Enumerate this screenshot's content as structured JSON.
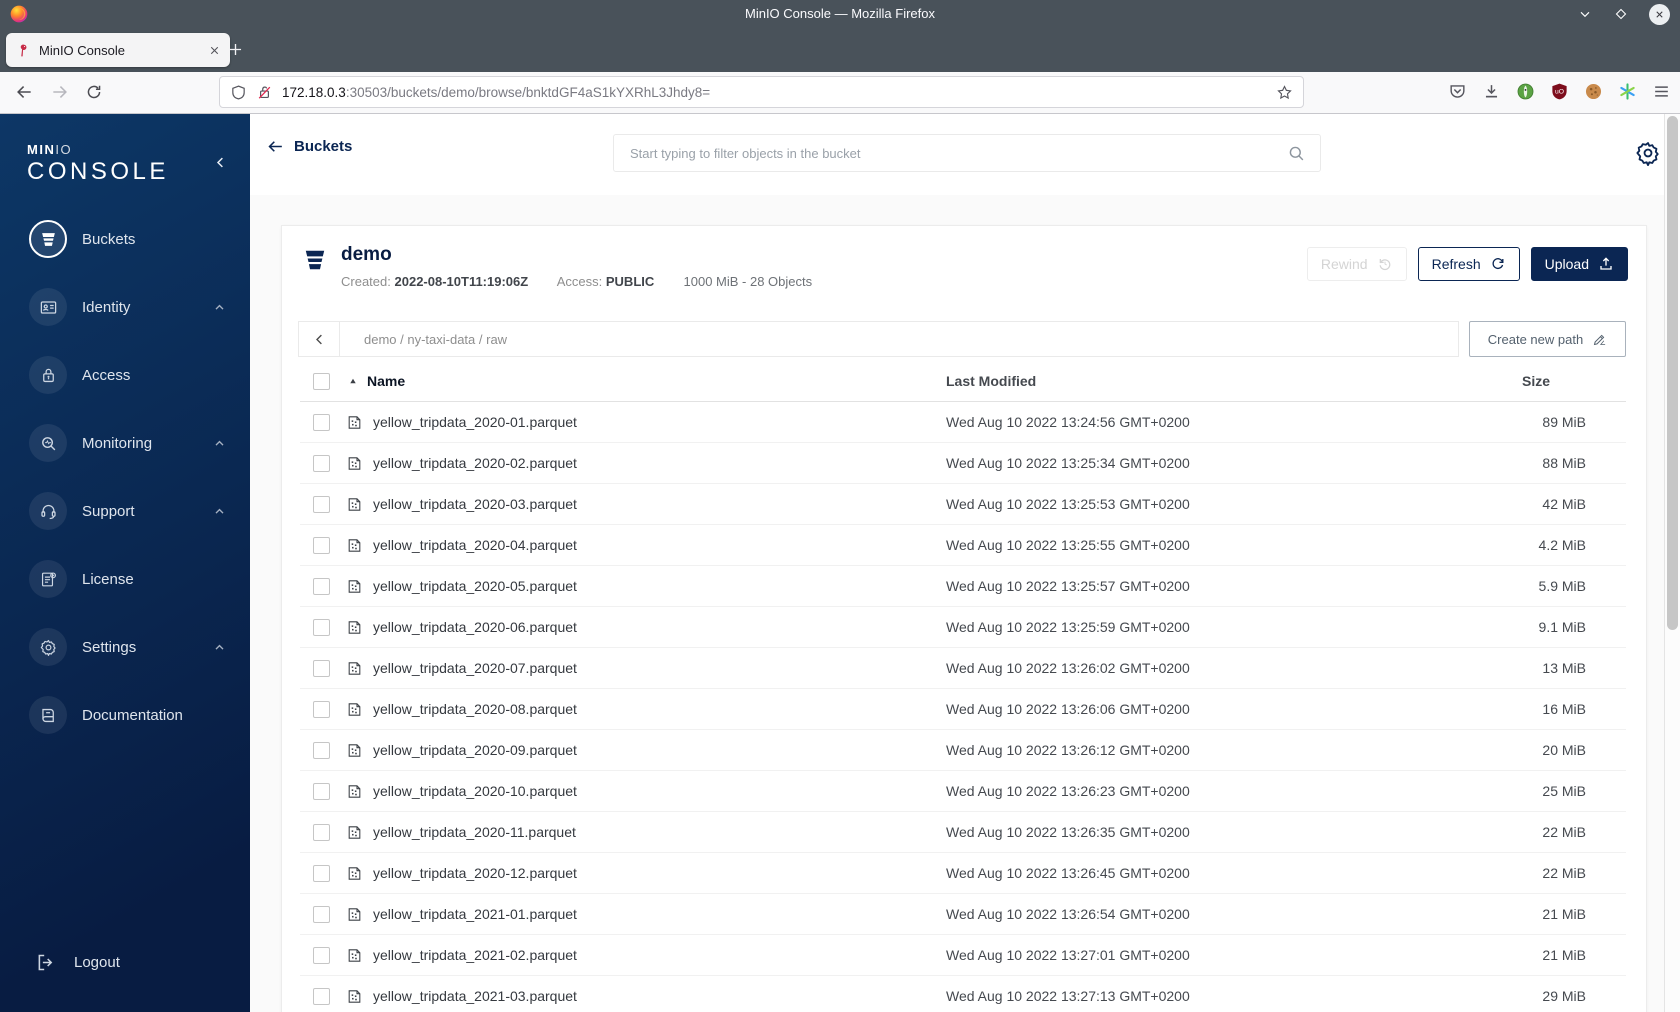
{
  "window": {
    "title": "MinIO Console — Mozilla Firefox"
  },
  "browser": {
    "tab_title": "MinIO Console",
    "url_host": "172.18.0.3",
    "url_rest": ":30503/buckets/demo/browse/bnktdGF4aS1kYXRhL3Jhdy8="
  },
  "sidebar": {
    "brand_min": "MIN",
    "brand_io": "IO",
    "brand_console": "CONSOLE",
    "items": [
      {
        "label": "Buckets",
        "icon": "bucket-icon",
        "active": true,
        "expandable": false
      },
      {
        "label": "Identity",
        "icon": "identity-icon",
        "active": false,
        "expandable": true
      },
      {
        "label": "Access",
        "icon": "access-icon",
        "active": false,
        "expandable": false
      },
      {
        "label": "Monitoring",
        "icon": "monitoring-icon",
        "active": false,
        "expandable": true
      },
      {
        "label": "Support",
        "icon": "support-icon",
        "active": false,
        "expandable": true
      },
      {
        "label": "License",
        "icon": "license-icon",
        "active": false,
        "expandable": false
      },
      {
        "label": "Settings",
        "icon": "settings-icon",
        "active": false,
        "expandable": true
      },
      {
        "label": "Documentation",
        "icon": "documentation-icon",
        "active": false,
        "expandable": false
      }
    ],
    "logout_label": "Logout"
  },
  "header": {
    "back_label": "Buckets",
    "search_placeholder": "Start typing to filter objects in the bucket"
  },
  "bucket": {
    "name": "demo",
    "created_label": "Created:",
    "created_value": "2022-08-10T11:19:06Z",
    "access_label": "Access:",
    "access_value": "PUBLIC",
    "usage": "1000 MiB - 28 Objects",
    "rewind_label": "Rewind",
    "refresh_label": "Refresh",
    "upload_label": "Upload"
  },
  "browse": {
    "breadcrumb": "demo / ny-taxi-data / raw",
    "create_path_label": "Create new path"
  },
  "table": {
    "columns": {
      "name": "Name",
      "modified": "Last Modified",
      "size": "Size"
    },
    "rows": [
      {
        "name": "yellow_tripdata_2020-01.parquet",
        "modified": "Wed Aug 10 2022 13:24:56 GMT+0200",
        "size": "89 MiB"
      },
      {
        "name": "yellow_tripdata_2020-02.parquet",
        "modified": "Wed Aug 10 2022 13:25:34 GMT+0200",
        "size": "88 MiB"
      },
      {
        "name": "yellow_tripdata_2020-03.parquet",
        "modified": "Wed Aug 10 2022 13:25:53 GMT+0200",
        "size": "42 MiB"
      },
      {
        "name": "yellow_tripdata_2020-04.parquet",
        "modified": "Wed Aug 10 2022 13:25:55 GMT+0200",
        "size": "4.2 MiB"
      },
      {
        "name": "yellow_tripdata_2020-05.parquet",
        "modified": "Wed Aug 10 2022 13:25:57 GMT+0200",
        "size": "5.9 MiB"
      },
      {
        "name": "yellow_tripdata_2020-06.parquet",
        "modified": "Wed Aug 10 2022 13:25:59 GMT+0200",
        "size": "9.1 MiB"
      },
      {
        "name": "yellow_tripdata_2020-07.parquet",
        "modified": "Wed Aug 10 2022 13:26:02 GMT+0200",
        "size": "13 MiB"
      },
      {
        "name": "yellow_tripdata_2020-08.parquet",
        "modified": "Wed Aug 10 2022 13:26:06 GMT+0200",
        "size": "16 MiB"
      },
      {
        "name": "yellow_tripdata_2020-09.parquet",
        "modified": "Wed Aug 10 2022 13:26:12 GMT+0200",
        "size": "20 MiB"
      },
      {
        "name": "yellow_tripdata_2020-10.parquet",
        "modified": "Wed Aug 10 2022 13:26:23 GMT+0200",
        "size": "25 MiB"
      },
      {
        "name": "yellow_tripdata_2020-11.parquet",
        "modified": "Wed Aug 10 2022 13:26:35 GMT+0200",
        "size": "22 MiB"
      },
      {
        "name": "yellow_tripdata_2020-12.parquet",
        "modified": "Wed Aug 10 2022 13:26:45 GMT+0200",
        "size": "22 MiB"
      },
      {
        "name": "yellow_tripdata_2021-01.parquet",
        "modified": "Wed Aug 10 2022 13:26:54 GMT+0200",
        "size": "21 MiB"
      },
      {
        "name": "yellow_tripdata_2021-02.parquet",
        "modified": "Wed Aug 10 2022 13:27:01 GMT+0200",
        "size": "21 MiB"
      },
      {
        "name": "yellow_tripdata_2021-03.parquet",
        "modified": "Wed Aug 10 2022 13:27:13 GMT+0200",
        "size": "29 MiB"
      }
    ]
  },
  "colors": {
    "accent_navy": "#081C42",
    "sidebar_gradient_top": "#0d3766",
    "sidebar_gradient_bottom": "#081c42",
    "minio_red": "#c72c48",
    "titlebar": "#49525a"
  }
}
